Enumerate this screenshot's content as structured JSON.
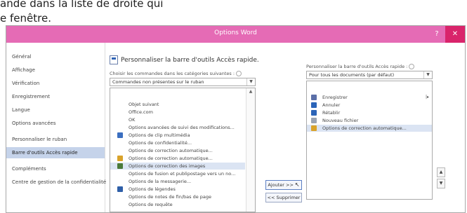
{
  "instructions": {
    "line1": "ande dans la liste de droite qui",
    "line2": "e fenêtre."
  },
  "dialog": {
    "title": "Options Word",
    "help_label": "?",
    "close_label": "✕"
  },
  "nav": {
    "items": [
      {
        "label": "Général",
        "selected": false
      },
      {
        "label": "Affichage",
        "selected": false
      },
      {
        "label": "Vérification",
        "selected": false
      },
      {
        "label": "Enregistrement",
        "selected": false
      },
      {
        "label": "Langue",
        "selected": false
      },
      {
        "label": "Options avancées",
        "selected": false
      },
      {
        "label": "Personnaliser le ruban",
        "selected": false
      },
      {
        "label": "Barre d'outils Accès rapide",
        "selected": true
      },
      {
        "label": "Compléments",
        "selected": false
      },
      {
        "label": "Centre de gestion de la confidentialité",
        "selected": false
      }
    ]
  },
  "main": {
    "heading": "Personnaliser la barre d'outils Accès rapide.",
    "choose_label": "Choisir les commandes dans les catégories suivantes :",
    "choose_value": "Commandes non présentes sur le ruban",
    "commands": [
      {
        "label": "Objet suivant",
        "icon": "none",
        "selected": false
      },
      {
        "label": "Office.com",
        "icon": "none",
        "selected": false
      },
      {
        "label": "OK",
        "icon": "none",
        "selected": false
      },
      {
        "label": "Options avancées de suivi des modifications...",
        "icon": "none",
        "selected": false
      },
      {
        "label": "Options de clip multimédia",
        "icon": "media-clip-icon",
        "selected": false
      },
      {
        "label": "Options de confidentialité...",
        "icon": "none",
        "selected": false
      },
      {
        "label": "Options de correction automatique...",
        "icon": "none",
        "selected": false
      },
      {
        "label": "Options de correction automatique...",
        "icon": "autocorrect-icon",
        "selected": false
      },
      {
        "label": "Options de correction des images",
        "icon": "picture-correction-icon",
        "selected": true
      },
      {
        "label": "Options de fusion et publipostage vers un no...",
        "icon": "none",
        "selected": false
      },
      {
        "label": "Options de la messagerie...",
        "icon": "none",
        "selected": false
      },
      {
        "label": "Options de légendes",
        "icon": "caption-icon",
        "selected": false
      },
      {
        "label": "Options de notes de fin/bas de page",
        "icon": "none",
        "selected": false
      },
      {
        "label": "Options de requête",
        "icon": "none",
        "selected": false
      }
    ],
    "add_button": "Ajouter >>",
    "remove_button": "<< Supprimer",
    "customize_label": "Personnaliser la barre d'outils Accès rapide :",
    "customize_value": "Pour tous les documents (par défaut)",
    "qat_items": [
      {
        "label": "Enregistrer",
        "icon": "save-icon",
        "selected": false,
        "expandable": true
      },
      {
        "label": "Annuler",
        "icon": "undo-icon",
        "selected": false,
        "expandable": false
      },
      {
        "label": "Rétablir",
        "icon": "redo-icon",
        "selected": false,
        "expandable": false
      },
      {
        "label": "Nouveau fichier",
        "icon": "new-file-icon",
        "selected": false,
        "expandable": false
      },
      {
        "label": "Options de correction automatique...",
        "icon": "autocorrect-icon",
        "selected": true,
        "expandable": false
      }
    ],
    "expand_mark": "|▸",
    "move_up": "▲",
    "move_down": "▼"
  },
  "colors": {
    "titlebar": "#e56bb5",
    "close_button": "#d9246b",
    "selection": "#c5d3ea",
    "list_selection": "#dbe4f3"
  }
}
